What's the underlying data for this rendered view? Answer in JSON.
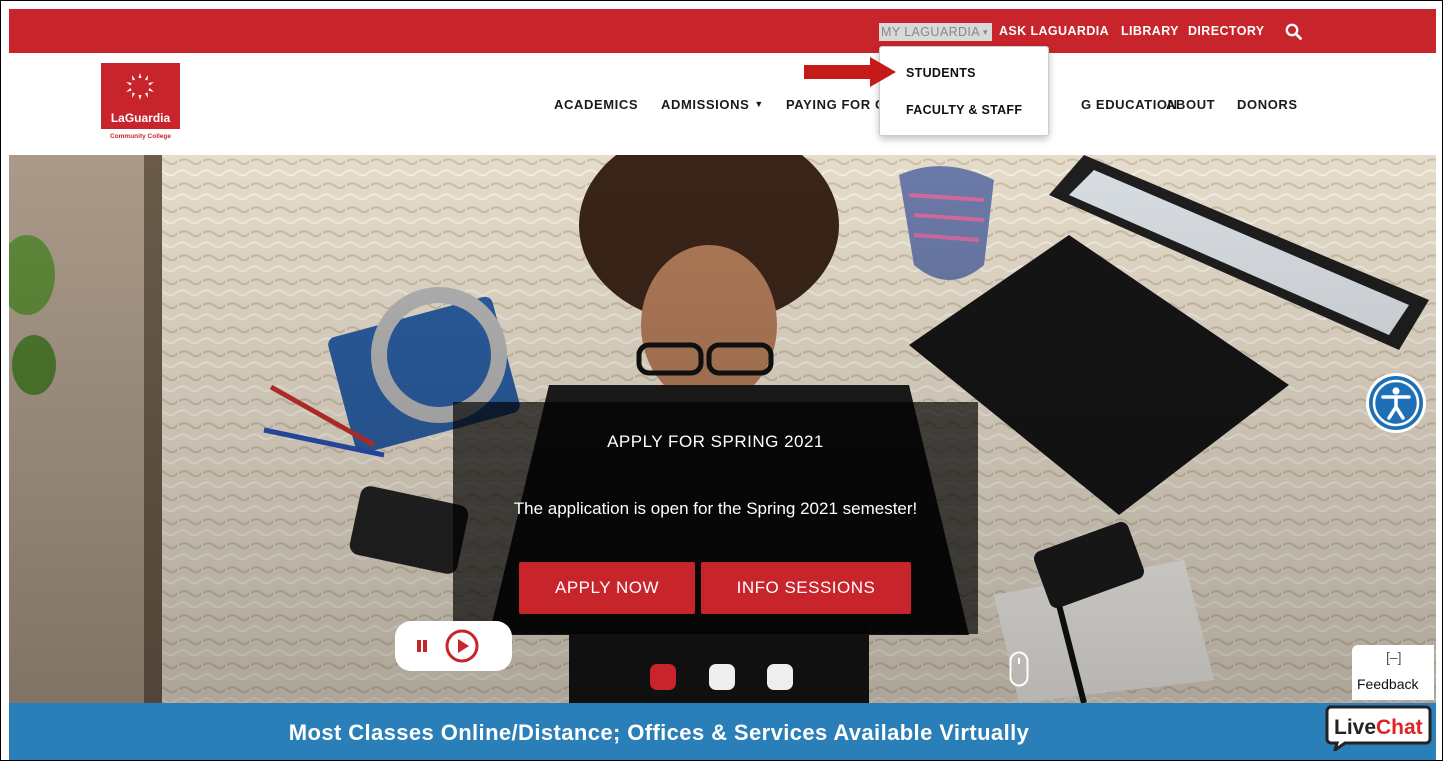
{
  "utility_nav": {
    "my_laguardia": "MY LAGUARDIA",
    "ask": "ASK LAGUARDIA",
    "library": "LIBRARY",
    "directory": "DIRECTORY"
  },
  "logo": {
    "name": "LaGuardia",
    "subtitle": "Community College"
  },
  "main_nav": {
    "academics": "ACADEMICS",
    "admissions": "ADMISSIONS",
    "paying": "PAYING FOR C",
    "continuing": "G EDUCATION",
    "about": "ABOUT",
    "donors": "DONORS"
  },
  "dropdown": {
    "students": "STUDENTS",
    "faculty": "FACULTY & STAFF"
  },
  "hero": {
    "title": "APPLY FOR SPRING 2021",
    "text": "The application is open for the Spring 2021 semester!",
    "apply_button": "APPLY NOW",
    "info_button": "INFO SESSIONS",
    "active_slide": 1,
    "slide_count": 3
  },
  "feedback": {
    "minimize": "[–]",
    "label": "Feedback"
  },
  "banner": {
    "text": "Most Classes Online/Distance; Offices & Services Available Virtually"
  },
  "livechat": {
    "live": "Live",
    "chat": "Chat"
  },
  "colors": {
    "brand_red": "#c8242b",
    "banner_blue": "#2b7fb8",
    "accessibility_blue": "#1e6fb5"
  },
  "icons": [
    "search-icon",
    "chevron-down-icon",
    "pause-icon",
    "play-icon",
    "scroll-mouse-icon",
    "accessibility-icon"
  ]
}
